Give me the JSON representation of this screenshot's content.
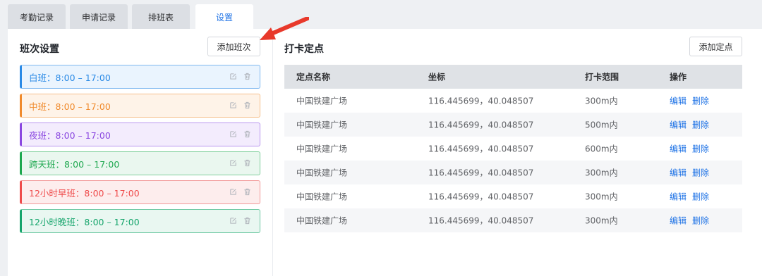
{
  "tabs": [
    {
      "label": "考勤记录"
    },
    {
      "label": "申请记录"
    },
    {
      "label": "排班表"
    },
    {
      "label": "设置"
    }
  ],
  "left": {
    "title": "班次设置",
    "add_button": "添加班次",
    "shifts": [
      {
        "label": "白班：8:00 – 17:00",
        "color": "#2a8ae6",
        "bg": "#eaf4fe",
        "border": "#7fb8f0"
      },
      {
        "label": "中班：8:00 – 17:00",
        "color": "#f08a2c",
        "bg": "#fef3e8",
        "border": "#f6bf8b"
      },
      {
        "label": "夜班：8:00 – 17:00",
        "color": "#8a47e0",
        "bg": "#f3ecfd",
        "border": "#b995ee"
      },
      {
        "label": "跨天班：8:00 – 17:00",
        "color": "#1ea84f",
        "bg": "#eaf7ef",
        "border": "#80cf9c"
      },
      {
        "label": "12小时早班：8:00 – 17:00",
        "color": "#ef4b4b",
        "bg": "#fdeded",
        "border": "#f29a9a"
      },
      {
        "label": "12小时晚班：8:00 – 17:00",
        "color": "#16a56c",
        "bg": "#e9f7f1",
        "border": "#6fc9a3"
      }
    ]
  },
  "right": {
    "title": "打卡定点",
    "add_button": "添加定点",
    "headers": [
      "定点名称",
      "坐标",
      "打卡范围",
      "操作"
    ],
    "rows": [
      {
        "name": "中国铁建广场",
        "coord": "116.445699，40.048507",
        "range": "300m内",
        "edit": "编辑",
        "delete": "删除"
      },
      {
        "name": "中国铁建广场",
        "coord": "116.445699，40.048507",
        "range": "500m内",
        "edit": "编辑",
        "delete": "删除"
      },
      {
        "name": "中国铁建广场",
        "coord": "116.445699，40.048507",
        "range": "600m内",
        "edit": "编辑",
        "delete": "删除"
      },
      {
        "name": "中国铁建广场",
        "coord": "116.445699，40.048507",
        "range": "300m内",
        "edit": "编辑",
        "delete": "删除"
      },
      {
        "name": "中国铁建广场",
        "coord": "116.445699，40.048507",
        "range": "300m内",
        "edit": "编辑",
        "delete": "删除"
      },
      {
        "name": "中国铁建广场",
        "coord": "116.445699，40.048507",
        "range": "300m内",
        "edit": "编辑",
        "delete": "删除"
      }
    ]
  }
}
